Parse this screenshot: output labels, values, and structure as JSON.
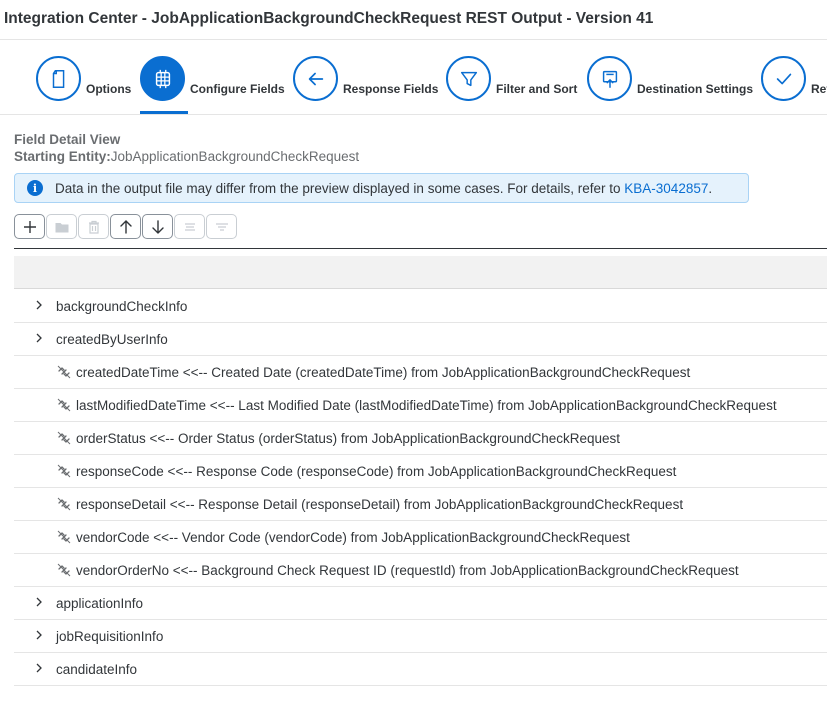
{
  "window": {
    "title": "Integration Center - JobApplicationBackgroundCheckRequest REST Output - Version 41"
  },
  "steps": [
    {
      "label": "Options",
      "icon": "document-icon",
      "active": false
    },
    {
      "label": "Configure Fields",
      "icon": "grid-icon",
      "active": true
    },
    {
      "label": "Response Fields",
      "icon": "arrow-left-icon",
      "active": false
    },
    {
      "label": "Filter and Sort",
      "icon": "filter-icon",
      "active": false
    },
    {
      "label": "Destination Settings",
      "icon": "upload-icon",
      "active": false
    },
    {
      "label": "Rev",
      "icon": "checkmark-icon",
      "active": false
    }
  ],
  "detail": {
    "title": "Field Detail View",
    "entity_label": "Starting Entity:",
    "entity_value": "JobApplicationBackgroundCheckRequest"
  },
  "info": {
    "text": "Data in the output file may differ from the preview displayed in some cases. For details, refer to ",
    "link": "KBA-3042857",
    "suffix": "."
  },
  "toolbar": {
    "buttons": [
      {
        "icon": "add-icon",
        "enabled": true
      },
      {
        "icon": "folder-icon",
        "enabled": false
      },
      {
        "icon": "delete-icon",
        "enabled": false
      },
      {
        "icon": "arrow-up-icon",
        "enabled": true
      },
      {
        "icon": "arrow-down-icon",
        "enabled": true
      },
      {
        "icon": "align-center-icon",
        "enabled": false
      },
      {
        "icon": "filter-lines-icon",
        "enabled": false
      }
    ]
  },
  "tree": {
    "rows": [
      {
        "type": "group",
        "label": "backgroundCheckInfo"
      },
      {
        "type": "group",
        "label": "createdByUserInfo"
      },
      {
        "type": "leaf",
        "label": "createdDateTime <<-- Created Date (createdDateTime) from JobApplicationBackgroundCheckRequest"
      },
      {
        "type": "leaf",
        "label": "lastModifiedDateTime <<-- Last Modified Date (lastModifiedDateTime) from JobApplicationBackgroundCheckRequest"
      },
      {
        "type": "leaf",
        "label": "orderStatus <<-- Order Status (orderStatus) from JobApplicationBackgroundCheckRequest"
      },
      {
        "type": "leaf",
        "label": "responseCode <<-- Response Code (responseCode) from JobApplicationBackgroundCheckRequest"
      },
      {
        "type": "leaf",
        "label": "responseDetail <<-- Response Detail (responseDetail) from JobApplicationBackgroundCheckRequest"
      },
      {
        "type": "leaf",
        "label": "vendorCode <<-- Vendor Code (vendorCode) from JobApplicationBackgroundCheckRequest"
      },
      {
        "type": "leaf",
        "label": "vendorOrderNo <<-- Background Check Request ID (requestId) from JobApplicationBackgroundCheckRequest"
      },
      {
        "type": "group",
        "label": "applicationInfo"
      },
      {
        "type": "group",
        "label": "jobRequisitionInfo"
      },
      {
        "type": "group",
        "label": "candidateInfo"
      }
    ]
  },
  "colors": {
    "accent": "#0a6ed1",
    "info_bg": "#e5f2fc",
    "text": "#32363a"
  }
}
